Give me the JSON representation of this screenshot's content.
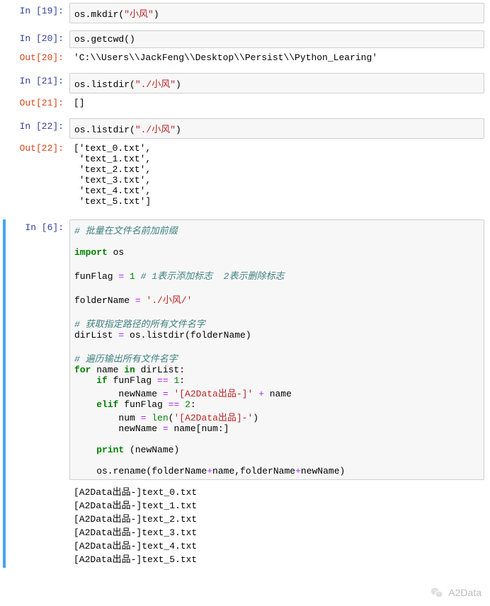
{
  "cells": {
    "c19": {
      "in_prompt": "In  [19]:",
      "code_pre": "os.mkdir(",
      "code_str": "\"小风\"",
      "code_post": ")"
    },
    "c20": {
      "in_prompt": "In  [20]:",
      "code": "os.getcwd()",
      "out_prompt": "Out[20]:",
      "out": "'C:\\\\Users\\\\JackFeng\\\\Desktop\\\\Persist\\\\Python_Learing'"
    },
    "c21": {
      "in_prompt": "In  [21]:",
      "code_pre": "os.listdir(",
      "code_str": "\"./小风\"",
      "code_post": ")",
      "out_prompt": "Out[21]:",
      "out": "[]"
    },
    "c22": {
      "in_prompt": "In  [22]:",
      "code_pre": "os.listdir(",
      "code_str": "\"./小风\"",
      "code_post": ")",
      "out_prompt": "Out[22]:",
      "out": "['text_0.txt',\n 'text_1.txt',\n 'text_2.txt',\n 'text_3.txt',\n 'text_4.txt',\n 'text_5.txt']"
    },
    "c6": {
      "in_prompt": "In  [6]:",
      "l1": "# 批量在文件名前加前缀",
      "l3a": "import",
      "l3b": " os",
      "l5a": "funFlag ",
      "l5eq": "=",
      "l5b": " ",
      "l5num": "1",
      "l5c": " ",
      "l5cm": "# 1表示添加标志  2表示删除标志",
      "l7a": "folderName ",
      "l7eq": "=",
      "l7b": " ",
      "l7str": "'./小风/'",
      "l9": "# 获取指定路径的所有文件名字",
      "l10a": "dirList ",
      "l10eq": "=",
      "l10b": " os.listdir(folderName)",
      "l12": "# 遍历输出所有文件名字",
      "l13a": "for",
      "l13b": " name ",
      "l13c": "in",
      "l13d": " dirList:",
      "l14a": "    ",
      "l14b": "if",
      "l14c": " funFlag ",
      "l14d": "==",
      "l14e": " ",
      "l14num": "1",
      "l14f": ":",
      "l15a": "        newName ",
      "l15eq": "=",
      "l15b": " ",
      "l15str": "'[A2Data出品-]'",
      "l15c": " ",
      "l15op": "+",
      "l15d": " name",
      "l16a": "    ",
      "l16b": "elif",
      "l16c": " funFlag ",
      "l16d": "==",
      "l16e": " ",
      "l16num": "2",
      "l16f": ":",
      "l17a": "        num ",
      "l17eq": "=",
      "l17b": " ",
      "l17fn": "len",
      "l17c": "(",
      "l17str": "'[A2Data出品]-'",
      "l17d": ")",
      "l18a": "        newName ",
      "l18eq": "=",
      "l18b": " name[num:]",
      "l20a": "    ",
      "l20b": "print",
      "l20c": " (newName)",
      "l22a": "    os.rename(folderName",
      "l22op1": "+",
      "l22b": "name,folderName",
      "l22op2": "+",
      "l22c": "newName)",
      "out": "[A2Data出品-]text_0.txt\n[A2Data出品-]text_1.txt\n[A2Data出品-]text_2.txt\n[A2Data出品-]text_3.txt\n[A2Data出品-]text_4.txt\n[A2Data出品-]text_5.txt"
    }
  },
  "watermark": "A2Data"
}
